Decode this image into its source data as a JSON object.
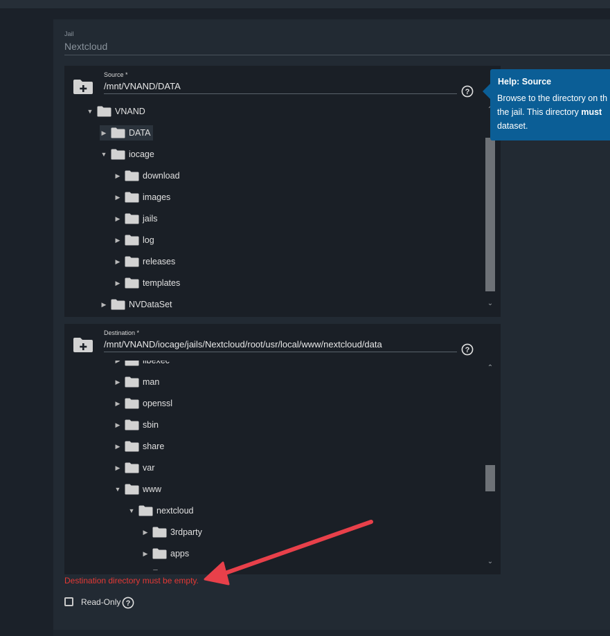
{
  "colors": {
    "background": "#1b2129",
    "card": "#222a33",
    "panel": "#1a1f26",
    "tooltip": "#0b5e96",
    "error": "#e53935",
    "annotation_arrow": "#e8404a"
  },
  "jail": {
    "label": "Jail",
    "value": "Nextcloud"
  },
  "source": {
    "label": "Source *",
    "value": "/mnt/VNAND/DATA",
    "add_icon": "folder-plus-icon",
    "help_icon": "help-circle-icon",
    "tree": [
      {
        "label": "VNAND",
        "depth": 0,
        "expanded": true
      },
      {
        "label": "DATA",
        "depth": 1,
        "expanded": false,
        "selected": true
      },
      {
        "label": "iocage",
        "depth": 1,
        "expanded": true
      },
      {
        "label": "download",
        "depth": 2,
        "expanded": false
      },
      {
        "label": "images",
        "depth": 2,
        "expanded": false
      },
      {
        "label": "jails",
        "depth": 2,
        "expanded": false
      },
      {
        "label": "log",
        "depth": 2,
        "expanded": false
      },
      {
        "label": "releases",
        "depth": 2,
        "expanded": false
      },
      {
        "label": "templates",
        "depth": 2,
        "expanded": false
      },
      {
        "label": "NVDataSet",
        "depth": 1,
        "expanded": false
      }
    ]
  },
  "destination": {
    "label": "Destination *",
    "value": "/mnt/VNAND/iocage/jails/Nextcloud/root/usr/local/www/nextcloud/data",
    "add_icon": "folder-plus-icon",
    "help_icon": "help-circle-icon",
    "tree": [
      {
        "label": "libexec",
        "depth": 2,
        "expanded": false
      },
      {
        "label": "man",
        "depth": 2,
        "expanded": false
      },
      {
        "label": "openssl",
        "depth": 2,
        "expanded": false
      },
      {
        "label": "sbin",
        "depth": 2,
        "expanded": false
      },
      {
        "label": "share",
        "depth": 2,
        "expanded": false
      },
      {
        "label": "var",
        "depth": 2,
        "expanded": false
      },
      {
        "label": "www",
        "depth": 2,
        "expanded": true
      },
      {
        "label": "nextcloud",
        "depth": 3,
        "expanded": true
      },
      {
        "label": "3rdparty",
        "depth": 4,
        "expanded": false
      },
      {
        "label": "apps",
        "depth": 4,
        "expanded": false
      },
      {
        "label": "",
        "depth": 4,
        "expanded": false
      }
    ]
  },
  "help_tooltip": {
    "title": "Help: Source",
    "line1": "Browse to the directory on th",
    "line2_prefix": "the jail. This directory ",
    "line2_bold": "must",
    "line3": "dataset."
  },
  "error_message": "Destination directory must be empty.",
  "read_only": {
    "label": "Read-Only",
    "checked": false,
    "help_icon": "help-circle-icon"
  }
}
